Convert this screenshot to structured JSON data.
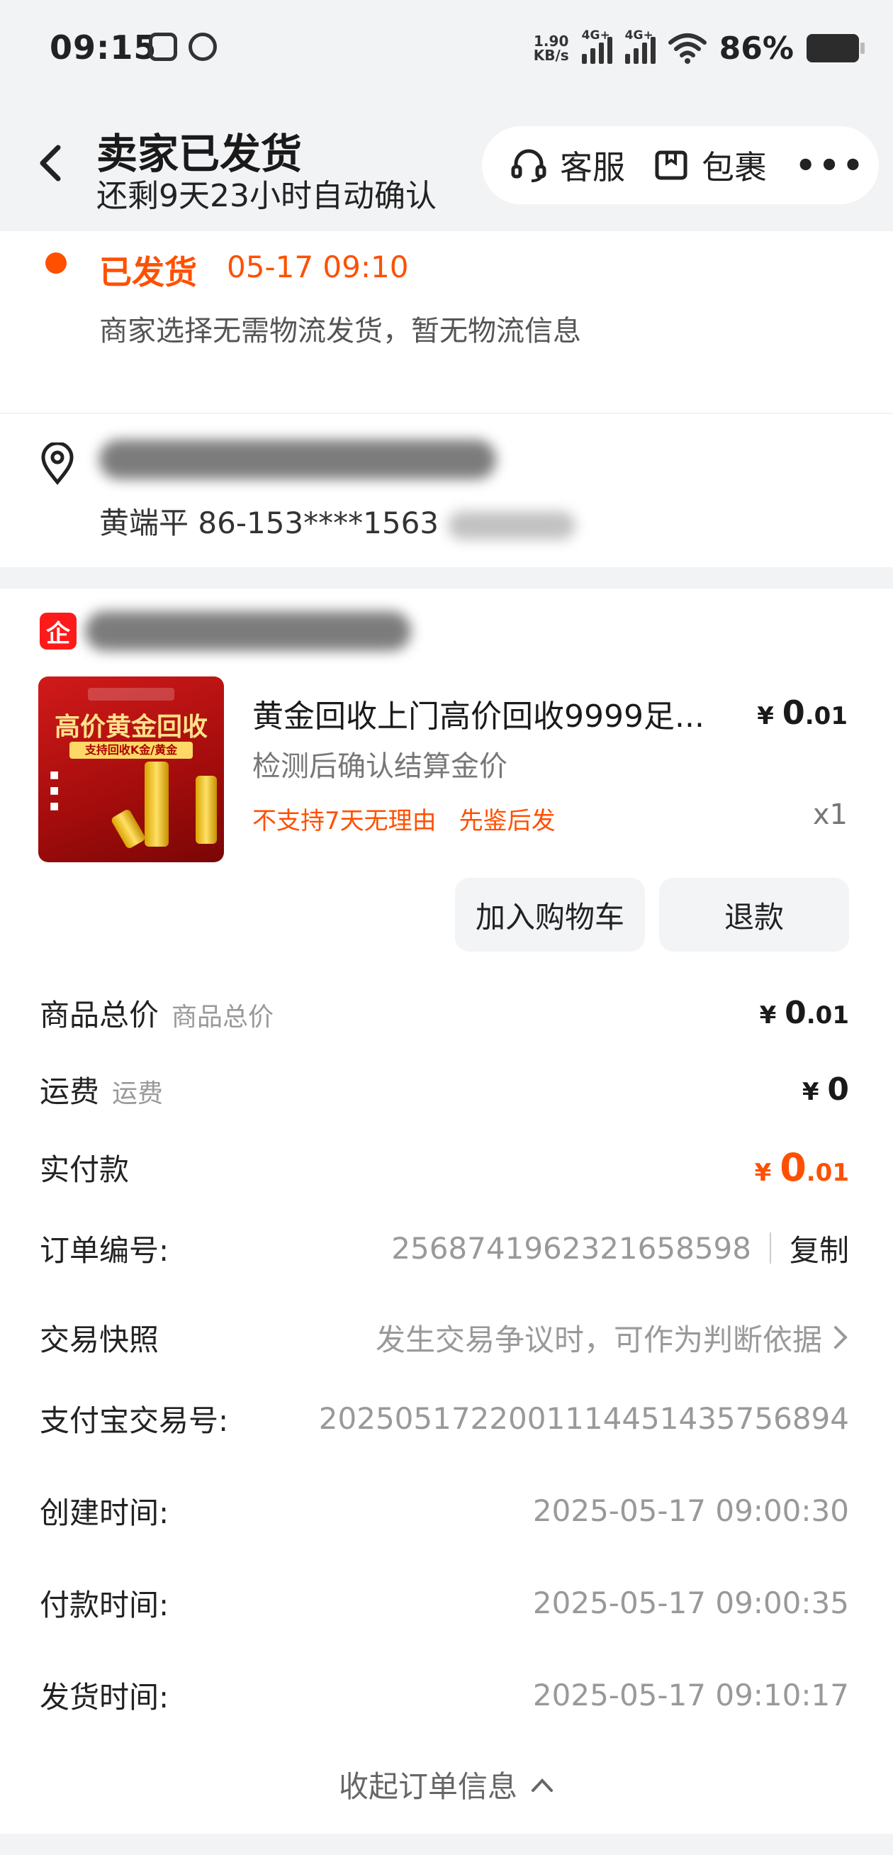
{
  "status_bar": {
    "time": "09:15",
    "net_speed_value": "1.90",
    "net_speed_unit": "KB/s",
    "signal1_tag": "4G+",
    "signal2_tag": "4G+",
    "battery": "86%"
  },
  "header": {
    "title": "卖家已发货",
    "subtitle": "还剩9天23小时自动确认",
    "service_label": "客服",
    "package_label": "包裹",
    "more_label": "•••"
  },
  "shipping": {
    "status": "已发货",
    "time": "05-17 09:10",
    "description": "商家选择无需物流发货，暂无物流信息"
  },
  "address": {
    "contact_name": "黄端平",
    "phone": "86-153****1563"
  },
  "shop": {
    "logo_text": "企"
  },
  "product": {
    "thumb_title": "高价黄金回收",
    "thumb_band": "支持回收K金/黄金",
    "name": "黄金回收上门高价回收9999足...",
    "price_symbol": "¥",
    "price_int": "0",
    "price_dec": ".01",
    "spec": "检测后确认结算金价",
    "tag1": "不支持7天无理由",
    "tag2": "先鉴后发",
    "qty": "x1"
  },
  "actions": {
    "cart_label": "加入购物车",
    "refund_label": "退款"
  },
  "summary": {
    "goods_total_label": "商品总价",
    "goods_total_sub": "商品总价",
    "goods_total_int": "0",
    "goods_total_dec": ".01",
    "shipping_label": "运费",
    "shipping_sub": "运费",
    "shipping_int": "0",
    "paid_label": "实付款",
    "paid_int": "0",
    "paid_dec": ".01",
    "currency": "¥"
  },
  "order_info": {
    "order_no_label": "订单编号:",
    "order_no": "2568741962321658598",
    "copy_label": "复制",
    "snapshot_label": "交易快照",
    "snapshot_value": "发生交易争议时，可作为判断依据",
    "alipay_label": "支付宝交易号:",
    "alipay_no": "2025051722001114451435756894",
    "created_label": "创建时间:",
    "created_time": "2025-05-17 09:00:30",
    "paid_label": "付款时间:",
    "paid_time": "2025-05-17 09:00:35",
    "shipped_label": "发货时间:",
    "shipped_time": "2025-05-17 09:10:17",
    "collapse_label": "收起订单信息"
  },
  "colors": {
    "accent": "#ff5000",
    "background": "#f2f3f5"
  }
}
